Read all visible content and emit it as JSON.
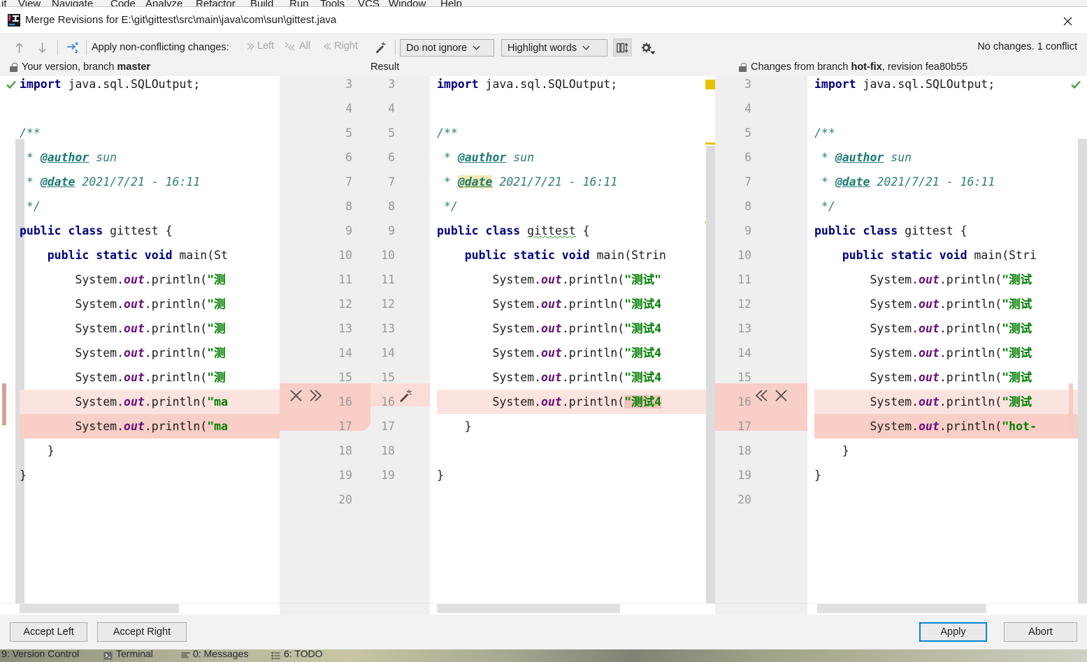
{
  "ide": {
    "menu_items": [
      "it",
      "View",
      "Navigate",
      "Code",
      "Analyze",
      "Refactor",
      "Build",
      "Run",
      "Tools",
      "VCS",
      "Window",
      "Help"
    ],
    "status_items": [
      "9: Version Control",
      "Terminal",
      "0: Messages",
      "6: TODO"
    ]
  },
  "dialog": {
    "title": "Merge Revisions for E:\\git\\gittest\\src\\main\\java\\com\\sun\\gittest.java",
    "close_label": "✕"
  },
  "toolbar": {
    "prev_label": "↑",
    "next_label": "↓",
    "apply_prefix": "Apply non-conflicting changes:",
    "apply_left": "Left",
    "apply_all": "All",
    "apply_right": "Right",
    "ignore_policy": "Do not ignore",
    "highlight_policy": "Highlight words",
    "caret": "⌄",
    "changes_summary": "No changes. 1 conflict"
  },
  "panes": {
    "left_header": "Your version, branch master",
    "left_header_plain": "Your version, branch ",
    "left_header_bold": "master",
    "center_header": "Result",
    "right_header_plain": "Changes from branch ",
    "right_header_bold": "hot-fix",
    "right_header_suffix": ", revision fea80b55"
  },
  "gutter": {
    "numbers_a": [
      "3",
      "4",
      "5",
      "6",
      "7",
      "8",
      "9",
      "10",
      "11",
      "12",
      "13",
      "14",
      "15",
      "16",
      "17",
      "18",
      "19",
      "20"
    ],
    "numbers_b": [
      "3",
      "4",
      "5",
      "6",
      "7",
      "8",
      "9",
      "10",
      "11",
      "12",
      "13",
      "14",
      "15",
      "16",
      "17",
      "18",
      "19"
    ],
    "right_numbers": [
      "3",
      "4",
      "5",
      "6",
      "7",
      "8",
      "9",
      "10",
      "11",
      "12",
      "13",
      "14",
      "15",
      "16",
      "17",
      "18",
      "19",
      "20"
    ],
    "icon_accept_left": "✕",
    "icon_push_right": "≫",
    "icon_push_left": "≪",
    "icon_reject": "✕",
    "icon_magic": "magic-wand-icon"
  },
  "code": {
    "left": [
      {
        "n": "3",
        "segments": [
          {
            "t": "import ",
            "c": "kw"
          },
          {
            "t": "java.sql.SQLOutput;",
            "c": "plain"
          }
        ]
      },
      {
        "n": "4",
        "segments": []
      },
      {
        "n": "5",
        "segments": [
          {
            "t": "/**",
            "c": "cmt"
          }
        ]
      },
      {
        "n": "6",
        "segments": [
          {
            "t": " * ",
            "c": "cmt"
          },
          {
            "t": "@author",
            "c": "tag"
          },
          {
            "t": " sun",
            "c": "cmt"
          }
        ]
      },
      {
        "n": "7",
        "segments": [
          {
            "t": " * ",
            "c": "cmt"
          },
          {
            "t": "@date",
            "c": "tag"
          },
          {
            "t": " 2021/7/21 - 16:11",
            "c": "cmt"
          }
        ]
      },
      {
        "n": "8",
        "segments": [
          {
            "t": " */",
            "c": "cmt"
          }
        ]
      },
      {
        "n": "9",
        "segments": [
          {
            "t": "public class ",
            "c": "kw"
          },
          {
            "t": "gittest {",
            "c": "plain"
          }
        ]
      },
      {
        "n": "10",
        "segments": [
          {
            "t": "    public static void ",
            "c": "kw"
          },
          {
            "t": "main(St",
            "c": "plain"
          }
        ]
      },
      {
        "n": "11",
        "segments": [
          {
            "t": "        System.",
            "c": "plain"
          },
          {
            "t": "out",
            "c": "fld"
          },
          {
            "t": ".println(",
            "c": "plain"
          },
          {
            "t": "\"测",
            "c": "str"
          }
        ]
      },
      {
        "n": "12",
        "segments": [
          {
            "t": "        System.",
            "c": "plain"
          },
          {
            "t": "out",
            "c": "fld"
          },
          {
            "t": ".println(",
            "c": "plain"
          },
          {
            "t": "\"测",
            "c": "str"
          }
        ]
      },
      {
        "n": "13",
        "segments": [
          {
            "t": "        System.",
            "c": "plain"
          },
          {
            "t": "out",
            "c": "fld"
          },
          {
            "t": ".println(",
            "c": "plain"
          },
          {
            "t": "\"测",
            "c": "str"
          }
        ]
      },
      {
        "n": "14",
        "segments": [
          {
            "t": "        System.",
            "c": "plain"
          },
          {
            "t": "out",
            "c": "fld"
          },
          {
            "t": ".println(",
            "c": "plain"
          },
          {
            "t": "\"测",
            "c": "str"
          }
        ]
      },
      {
        "n": "15",
        "segments": [
          {
            "t": "        System.",
            "c": "plain"
          },
          {
            "t": "out",
            "c": "fld"
          },
          {
            "t": ".println(",
            "c": "plain"
          },
          {
            "t": "\"测",
            "c": "str"
          }
        ]
      },
      {
        "n": "16",
        "segments": [
          {
            "t": "        System.",
            "c": "plain"
          },
          {
            "t": "out",
            "c": "fld"
          },
          {
            "t": ".println(",
            "c": "plain"
          },
          {
            "t": "\"ma",
            "c": "str"
          }
        ],
        "hl": "soft"
      },
      {
        "n": "17",
        "segments": [
          {
            "t": "        System.",
            "c": "plain"
          },
          {
            "t": "out",
            "c": "fld"
          },
          {
            "t": ".println(",
            "c": "plain"
          },
          {
            "t": "\"ma",
            "c": "str"
          }
        ],
        "hl": "hard"
      },
      {
        "n": "18",
        "segments": [
          {
            "t": "    }",
            "c": "plain"
          }
        ]
      },
      {
        "n": "19",
        "segments": [
          {
            "t": "}",
            "c": "plain"
          }
        ]
      }
    ],
    "center": [
      {
        "n": "3",
        "segments": [
          {
            "t": "import ",
            "c": "kw"
          },
          {
            "t": "java.sql.SQLOutput;",
            "c": "plain"
          }
        ]
      },
      {
        "n": "4",
        "segments": []
      },
      {
        "n": "5",
        "segments": [
          {
            "t": "/**",
            "c": "cmt"
          }
        ]
      },
      {
        "n": "6",
        "segments": [
          {
            "t": " * ",
            "c": "cmt"
          },
          {
            "t": "@author",
            "c": "tag"
          },
          {
            "t": " sun",
            "c": "cmt"
          }
        ]
      },
      {
        "n": "7",
        "segments": [
          {
            "t": " * ",
            "c": "cmt"
          },
          {
            "t": "@date",
            "c": "tag",
            "mark": "search"
          },
          {
            "t": " 2021/7/21 - 16:11",
            "c": "cmt"
          }
        ]
      },
      {
        "n": "8",
        "segments": [
          {
            "t": " */",
            "c": "cmt"
          }
        ]
      },
      {
        "n": "9",
        "segments": [
          {
            "t": "public class ",
            "c": "kw"
          },
          {
            "t": "gittest",
            "c": "plain",
            "squiggle": true
          },
          {
            "t": " {",
            "c": "plain"
          }
        ]
      },
      {
        "n": "10",
        "segments": [
          {
            "t": "    public static void ",
            "c": "kw"
          },
          {
            "t": "main(Strin",
            "c": "plain"
          }
        ]
      },
      {
        "n": "11",
        "segments": [
          {
            "t": "        System.",
            "c": "plain"
          },
          {
            "t": "out",
            "c": "fld"
          },
          {
            "t": ".println(",
            "c": "plain"
          },
          {
            "t": "\"测试\"",
            "c": "str"
          }
        ]
      },
      {
        "n": "12",
        "segments": [
          {
            "t": "        System.",
            "c": "plain"
          },
          {
            "t": "out",
            "c": "fld"
          },
          {
            "t": ".println(",
            "c": "plain"
          },
          {
            "t": "\"测试4",
            "c": "str"
          }
        ]
      },
      {
        "n": "13",
        "segments": [
          {
            "t": "        System.",
            "c": "plain"
          },
          {
            "t": "out",
            "c": "fld"
          },
          {
            "t": ".println(",
            "c": "plain"
          },
          {
            "t": "\"测试4",
            "c": "str"
          }
        ]
      },
      {
        "n": "14",
        "segments": [
          {
            "t": "        System.",
            "c": "plain"
          },
          {
            "t": "out",
            "c": "fld"
          },
          {
            "t": ".println(",
            "c": "plain"
          },
          {
            "t": "\"测试4",
            "c": "str"
          }
        ]
      },
      {
        "n": "15",
        "segments": [
          {
            "t": "        System.",
            "c": "plain"
          },
          {
            "t": "out",
            "c": "fld"
          },
          {
            "t": ".println(",
            "c": "plain"
          },
          {
            "t": "\"测试4",
            "c": "str"
          }
        ]
      },
      {
        "n": "16",
        "segments": [
          {
            "t": "        System.",
            "c": "plain"
          },
          {
            "t": "out",
            "c": "fld"
          },
          {
            "t": ".println(",
            "c": "plain"
          },
          {
            "t": "\"测试4",
            "c": "str",
            "mark": "word"
          }
        ],
        "hl": "soft"
      },
      {
        "n": "17",
        "segments": [
          {
            "t": "    }",
            "c": "plain"
          }
        ]
      },
      {
        "n": "18",
        "segments": []
      },
      {
        "n": "19",
        "segments": [
          {
            "t": "}",
            "c": "plain"
          }
        ]
      }
    ],
    "right": [
      {
        "n": "3",
        "segments": [
          {
            "t": "import ",
            "c": "kw"
          },
          {
            "t": "java.sql.SQLOutput;",
            "c": "plain"
          }
        ]
      },
      {
        "n": "4",
        "segments": []
      },
      {
        "n": "5",
        "segments": [
          {
            "t": "/**",
            "c": "cmt"
          }
        ]
      },
      {
        "n": "6",
        "segments": [
          {
            "t": " * ",
            "c": "cmt"
          },
          {
            "t": "@author",
            "c": "tag"
          },
          {
            "t": " sun",
            "c": "cmt"
          }
        ]
      },
      {
        "n": "7",
        "segments": [
          {
            "t": " * ",
            "c": "cmt"
          },
          {
            "t": "@date",
            "c": "tag"
          },
          {
            "t": " 2021/7/21 - 16:11",
            "c": "cmt"
          }
        ]
      },
      {
        "n": "8",
        "segments": [
          {
            "t": " */",
            "c": "cmt"
          }
        ]
      },
      {
        "n": "9",
        "segments": [
          {
            "t": "public class ",
            "c": "kw"
          },
          {
            "t": "gittest {",
            "c": "plain"
          }
        ]
      },
      {
        "n": "10",
        "segments": [
          {
            "t": "    public static void ",
            "c": "kw"
          },
          {
            "t": "main(Stri",
            "c": "plain"
          }
        ]
      },
      {
        "n": "11",
        "segments": [
          {
            "t": "        System.",
            "c": "plain"
          },
          {
            "t": "out",
            "c": "fld"
          },
          {
            "t": ".println(",
            "c": "plain"
          },
          {
            "t": "\"测试",
            "c": "str"
          }
        ]
      },
      {
        "n": "12",
        "segments": [
          {
            "t": "        System.",
            "c": "plain"
          },
          {
            "t": "out",
            "c": "fld"
          },
          {
            "t": ".println(",
            "c": "plain"
          },
          {
            "t": "\"测试",
            "c": "str"
          }
        ]
      },
      {
        "n": "13",
        "segments": [
          {
            "t": "        System.",
            "c": "plain"
          },
          {
            "t": "out",
            "c": "fld"
          },
          {
            "t": ".println(",
            "c": "plain"
          },
          {
            "t": "\"测试",
            "c": "str"
          }
        ]
      },
      {
        "n": "14",
        "segments": [
          {
            "t": "        System.",
            "c": "plain"
          },
          {
            "t": "out",
            "c": "fld"
          },
          {
            "t": ".println(",
            "c": "plain"
          },
          {
            "t": "\"测试",
            "c": "str"
          }
        ]
      },
      {
        "n": "15",
        "segments": [
          {
            "t": "        System.",
            "c": "plain"
          },
          {
            "t": "out",
            "c": "fld"
          },
          {
            "t": ".println(",
            "c": "plain"
          },
          {
            "t": "\"测试",
            "c": "str"
          }
        ]
      },
      {
        "n": "16",
        "segments": [
          {
            "t": "        System.",
            "c": "plain"
          },
          {
            "t": "out",
            "c": "fld"
          },
          {
            "t": ".println(",
            "c": "plain"
          },
          {
            "t": "\"测试",
            "c": "str"
          }
        ],
        "hl": "soft"
      },
      {
        "n": "17",
        "segments": [
          {
            "t": "        System.",
            "c": "plain"
          },
          {
            "t": "out",
            "c": "fld"
          },
          {
            "t": ".println(",
            "c": "plain"
          },
          {
            "t": "\"hot-",
            "c": "str"
          }
        ],
        "hl": "hard"
      },
      {
        "n": "18",
        "segments": [
          {
            "t": "    }",
            "c": "plain"
          }
        ]
      },
      {
        "n": "19",
        "segments": [
          {
            "t": "}",
            "c": "plain"
          }
        ]
      }
    ]
  },
  "buttons": {
    "accept_left": "Accept Left",
    "accept_right": "Accept Right",
    "apply": "Apply",
    "abort": "Abort"
  },
  "colors": {
    "conflict_soft": "#fbe3df",
    "conflict_hard": "#f8cec6",
    "accent": "#0a84d8",
    "ok_green": "#4a9e4a",
    "marker_yellow": "#e8c000"
  }
}
